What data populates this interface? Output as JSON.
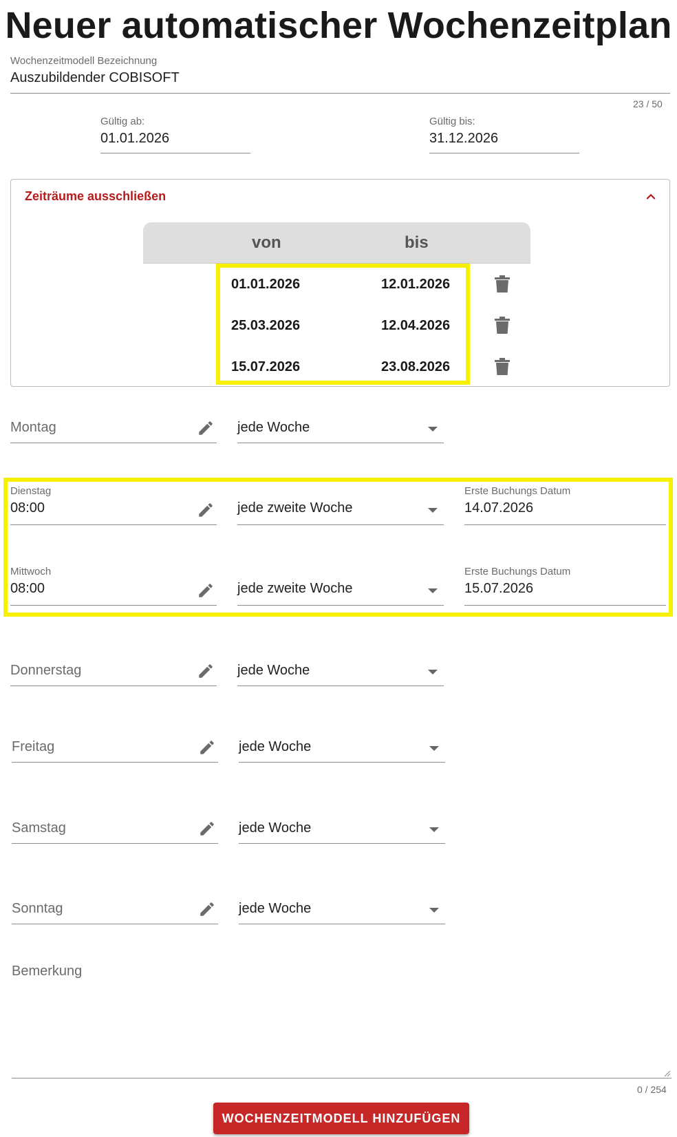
{
  "title": "Neuer automatischer Wochenzeitplan",
  "model": {
    "label": "Wochenzeitmodell Bezeichnung",
    "value": "Auszubildender COBISOFT",
    "counter": "23 / 50"
  },
  "valid_from": {
    "label": "Gültig ab:",
    "value": "01.01.2026"
  },
  "valid_to": {
    "label": "Gültig bis:",
    "value": "31.12.2026"
  },
  "exclude": {
    "title": "Zeiträume ausschließen",
    "col_from": "von",
    "col_to": "bis",
    "rows": [
      {
        "from": "01.01.2026",
        "to": "12.01.2026"
      },
      {
        "from": "25.03.2026",
        "to": "12.04.2026"
      },
      {
        "from": "15.07.2026",
        "to": "23.08.2026"
      }
    ]
  },
  "days": {
    "montag": {
      "label": "Montag",
      "value": "",
      "freq": "jede Woche"
    },
    "dienstag": {
      "label": "Dienstag",
      "value": "08:00",
      "freq": "jede zweite Woche",
      "first_label": "Erste Buchungs Datum",
      "first_value": "14.07.2026"
    },
    "mittwoch": {
      "label": "Mittwoch",
      "value": "08:00",
      "freq": "jede zweite Woche",
      "first_label": "Erste Buchungs Datum",
      "first_value": "15.07.2026"
    },
    "donnerstag": {
      "label": "Donnerstag",
      "value": "",
      "freq": "jede Woche"
    },
    "freitag": {
      "label": "Freitag",
      "value": "",
      "freq": "jede Woche"
    },
    "samstag": {
      "label": "Samstag",
      "value": "",
      "freq": "jede Woche"
    },
    "sonntag": {
      "label": "Sonntag",
      "value": "",
      "freq": "jede Woche"
    }
  },
  "remark": {
    "label": "Bemerkung",
    "counter": "0 / 254"
  },
  "submit_label": "WOCHENZEITMODELL HINZUFÜGEN",
  "colors": {
    "accent": "#c62828",
    "highlight": "#f7f000",
    "table_header": "#dedede"
  }
}
